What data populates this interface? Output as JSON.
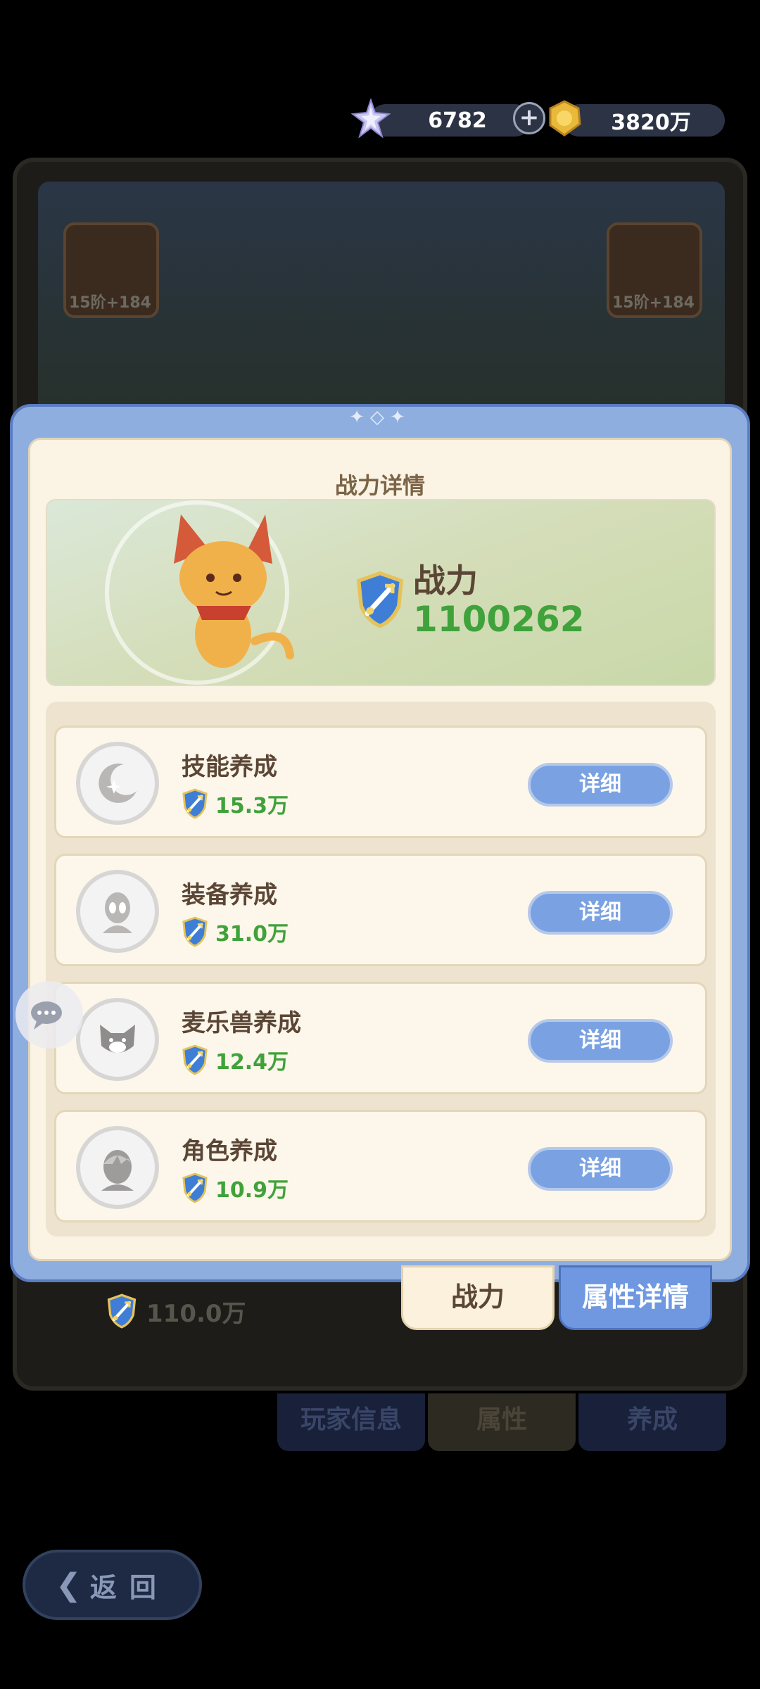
{
  "currency": {
    "gems": "6782",
    "gold": "3820万",
    "gem_icon": "star-crystal-icon",
    "gold_icon": "gold-coin-icon"
  },
  "background": {
    "gear_tag_left": "15阶+184",
    "gear_tag_right": "15阶+184",
    "power_total": "110.0万",
    "tabs": [
      "玩家信息",
      "属性",
      "养成"
    ]
  },
  "dialog": {
    "title": "战力详情",
    "power_label": "战力",
    "power_value": "1100262",
    "rows": [
      {
        "title": "技能养成",
        "value": "15.3万",
        "button": "详细",
        "icon": "moon-star-icon"
      },
      {
        "title": "装备养成",
        "value": "31.0万",
        "button": "详细",
        "icon": "alien-head-icon"
      },
      {
        "title": "麦乐兽养成",
        "value": "12.4万",
        "button": "详细",
        "icon": "cat-face-icon"
      },
      {
        "title": "角色养成",
        "value": "10.9万",
        "button": "详细",
        "icon": "character-head-icon"
      }
    ],
    "tabs": {
      "power": "战力",
      "attributes": "属性详情"
    }
  },
  "back_button": "返回"
}
